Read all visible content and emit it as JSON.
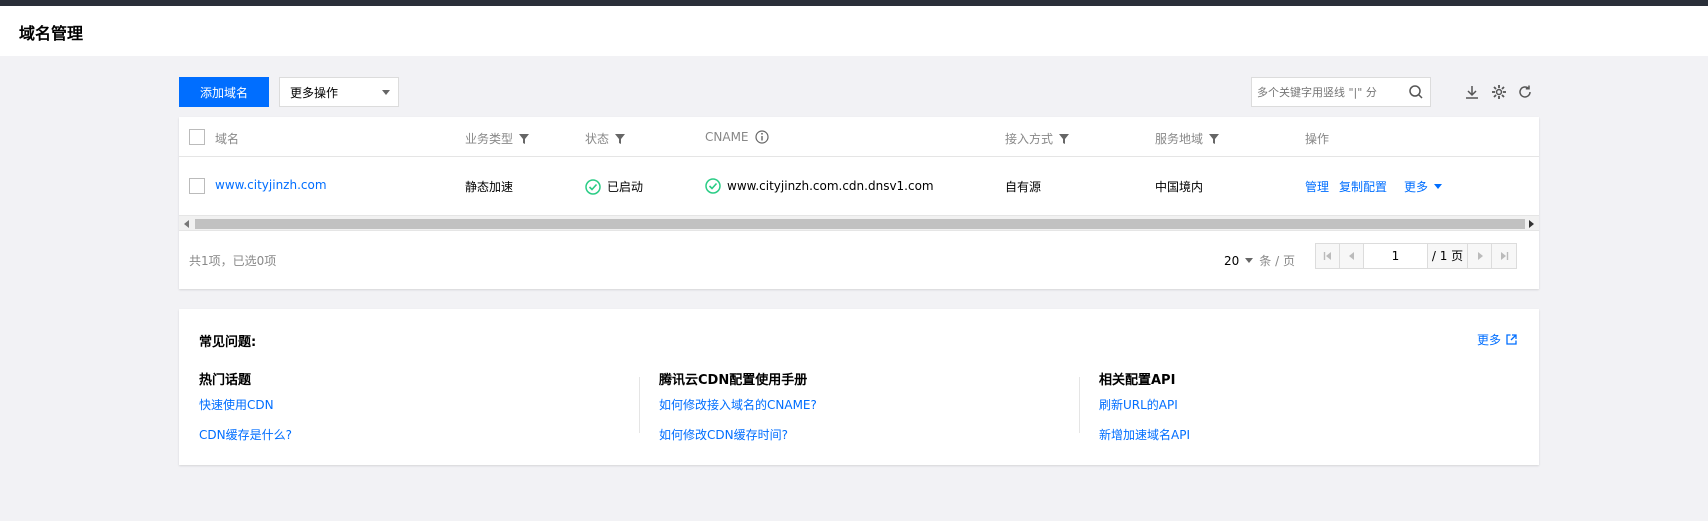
{
  "page": {
    "title": "域名管理"
  },
  "toolbar": {
    "add_button": "添加域名",
    "more_ops": "更多操作",
    "search_placeholder": "多个关键字用竖线 \"|\" 分"
  },
  "table": {
    "columns": [
      "域名",
      "业务类型",
      "状态",
      "CNAME",
      "接入方式",
      "服务地域",
      "操作"
    ],
    "rows": [
      {
        "domain": "www.cityjinzh.com",
        "business_type": "静态加速",
        "status": "已启动",
        "cname": "www.cityjinzh.com.cdn.dnsv1.com",
        "access": "自有源",
        "region": "中国境内",
        "actions": [
          "管理",
          "复制配置",
          "更多"
        ]
      }
    ],
    "summary": "共1项，已选0项",
    "page_size": "20",
    "page_size_unit": "条 / 页",
    "current_page": "1",
    "total_pages": "/ 1 页"
  },
  "faq": {
    "title": "常见问题:",
    "more": "更多",
    "sections": [
      {
        "heading": "热门话题",
        "links": [
          "快速使用CDN",
          "CDN缓存是什么?"
        ]
      },
      {
        "heading": "腾讯云CDN配置使用手册",
        "links": [
          "如何修改接入域名的CNAME?",
          "如何修改CDN缓存时间?"
        ]
      },
      {
        "heading": "相关配置API",
        "links": [
          "刷新URL的API",
          "新增加速域名API"
        ]
      }
    ]
  },
  "colors": {
    "primary": "#006eff",
    "success": "#29cc85",
    "topbar": "#2a2f39"
  }
}
